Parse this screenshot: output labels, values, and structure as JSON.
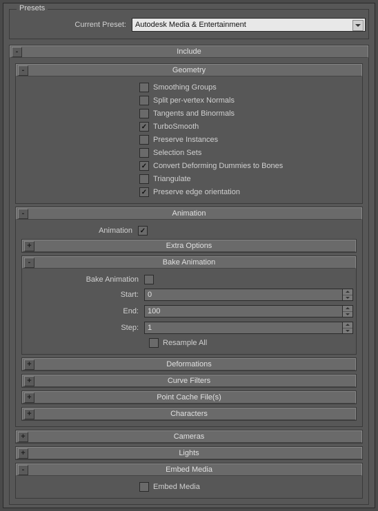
{
  "presets": {
    "title": "Presets",
    "current_preset_label": "Current Preset:",
    "current_preset_value": "Autodesk Media & Entertainment"
  },
  "include": {
    "title": "Include",
    "geometry": {
      "title": "Geometry",
      "items": [
        {
          "label": "Smoothing Groups",
          "checked": false
        },
        {
          "label": "Split per-vertex Normals",
          "checked": false
        },
        {
          "label": "Tangents and Binormals",
          "checked": false
        },
        {
          "label": "TurboSmooth",
          "checked": true
        },
        {
          "label": "Preserve Instances",
          "checked": false
        },
        {
          "label": "Selection Sets",
          "checked": false
        },
        {
          "label": "Convert Deforming Dummies to Bones",
          "checked": true
        },
        {
          "label": "Triangulate",
          "checked": false
        },
        {
          "label": "Preserve edge orientation",
          "checked": true
        }
      ]
    },
    "animation": {
      "title": "Animation",
      "enable_label": "Animation",
      "enable_checked": true,
      "extra_options": "Extra Options",
      "bake": {
        "title": "Bake Animation",
        "label": "Bake Animation",
        "checked": false,
        "start_label": "Start:",
        "start_value": "0",
        "end_label": "End:",
        "end_value": "100",
        "step_label": "Step:",
        "step_value": "1",
        "resample_label": "Resample All",
        "resample_checked": false
      },
      "deformations": "Deformations",
      "curve_filters": "Curve Filters",
      "point_cache": "Point Cache File(s)",
      "characters": "Characters"
    },
    "cameras": "Cameras",
    "lights": "Lights",
    "embed_media": {
      "title": "Embed Media",
      "label": "Embed Media",
      "checked": false
    }
  }
}
